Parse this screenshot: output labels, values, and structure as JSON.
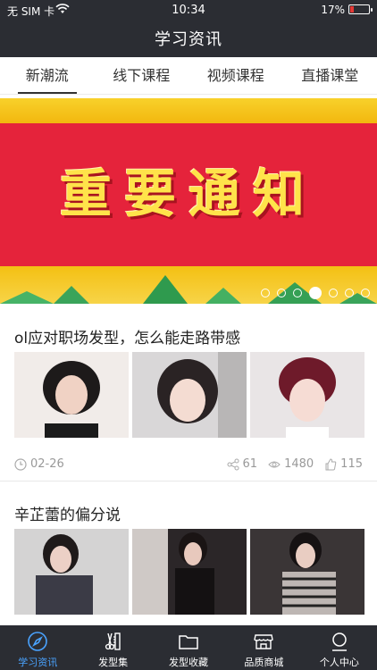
{
  "status_bar": {
    "carrier": "无 SIM 卡",
    "time": "10:34",
    "battery": "17%"
  },
  "nav": {
    "title": "学习资讯"
  },
  "tabs": [
    {
      "label": "新潮流",
      "active": true
    },
    {
      "label": "线下课程",
      "active": false
    },
    {
      "label": "视频课程",
      "active": false
    },
    {
      "label": "直播课堂",
      "active": false
    }
  ],
  "banner": {
    "headline": "重要通知",
    "slide_count": 7,
    "active_slide": 4
  },
  "articles": [
    {
      "title": "ol应对职场发型，怎么能走路带感",
      "date": "02-26",
      "shares": "61",
      "views": "1480",
      "likes": "115",
      "photos": [
        "short-bob-portrait",
        "bob-selfie",
        "burgundy-bowl-cut"
      ]
    },
    {
      "title": "辛芷蕾的偏分说",
      "photos": [
        "tweed-jacket-portrait",
        "black-dress-portrait",
        "houndstooth-portrait"
      ]
    }
  ],
  "tabbar": [
    {
      "label": "学习资讯",
      "icon": "compass-icon",
      "active": true
    },
    {
      "label": "发型集",
      "icon": "scissors-comb-icon",
      "active": false
    },
    {
      "label": "发型收藏",
      "icon": "folder-icon",
      "active": false
    },
    {
      "label": "品质商城",
      "icon": "shop-icon",
      "active": false
    },
    {
      "label": "个人中心",
      "icon": "person-icon",
      "active": false
    }
  ],
  "colors": {
    "bar_bg": "#2b2d33",
    "accent": "#4aa3ff",
    "banner_red": "#e5233b",
    "banner_yellow": "#f6c516"
  }
}
